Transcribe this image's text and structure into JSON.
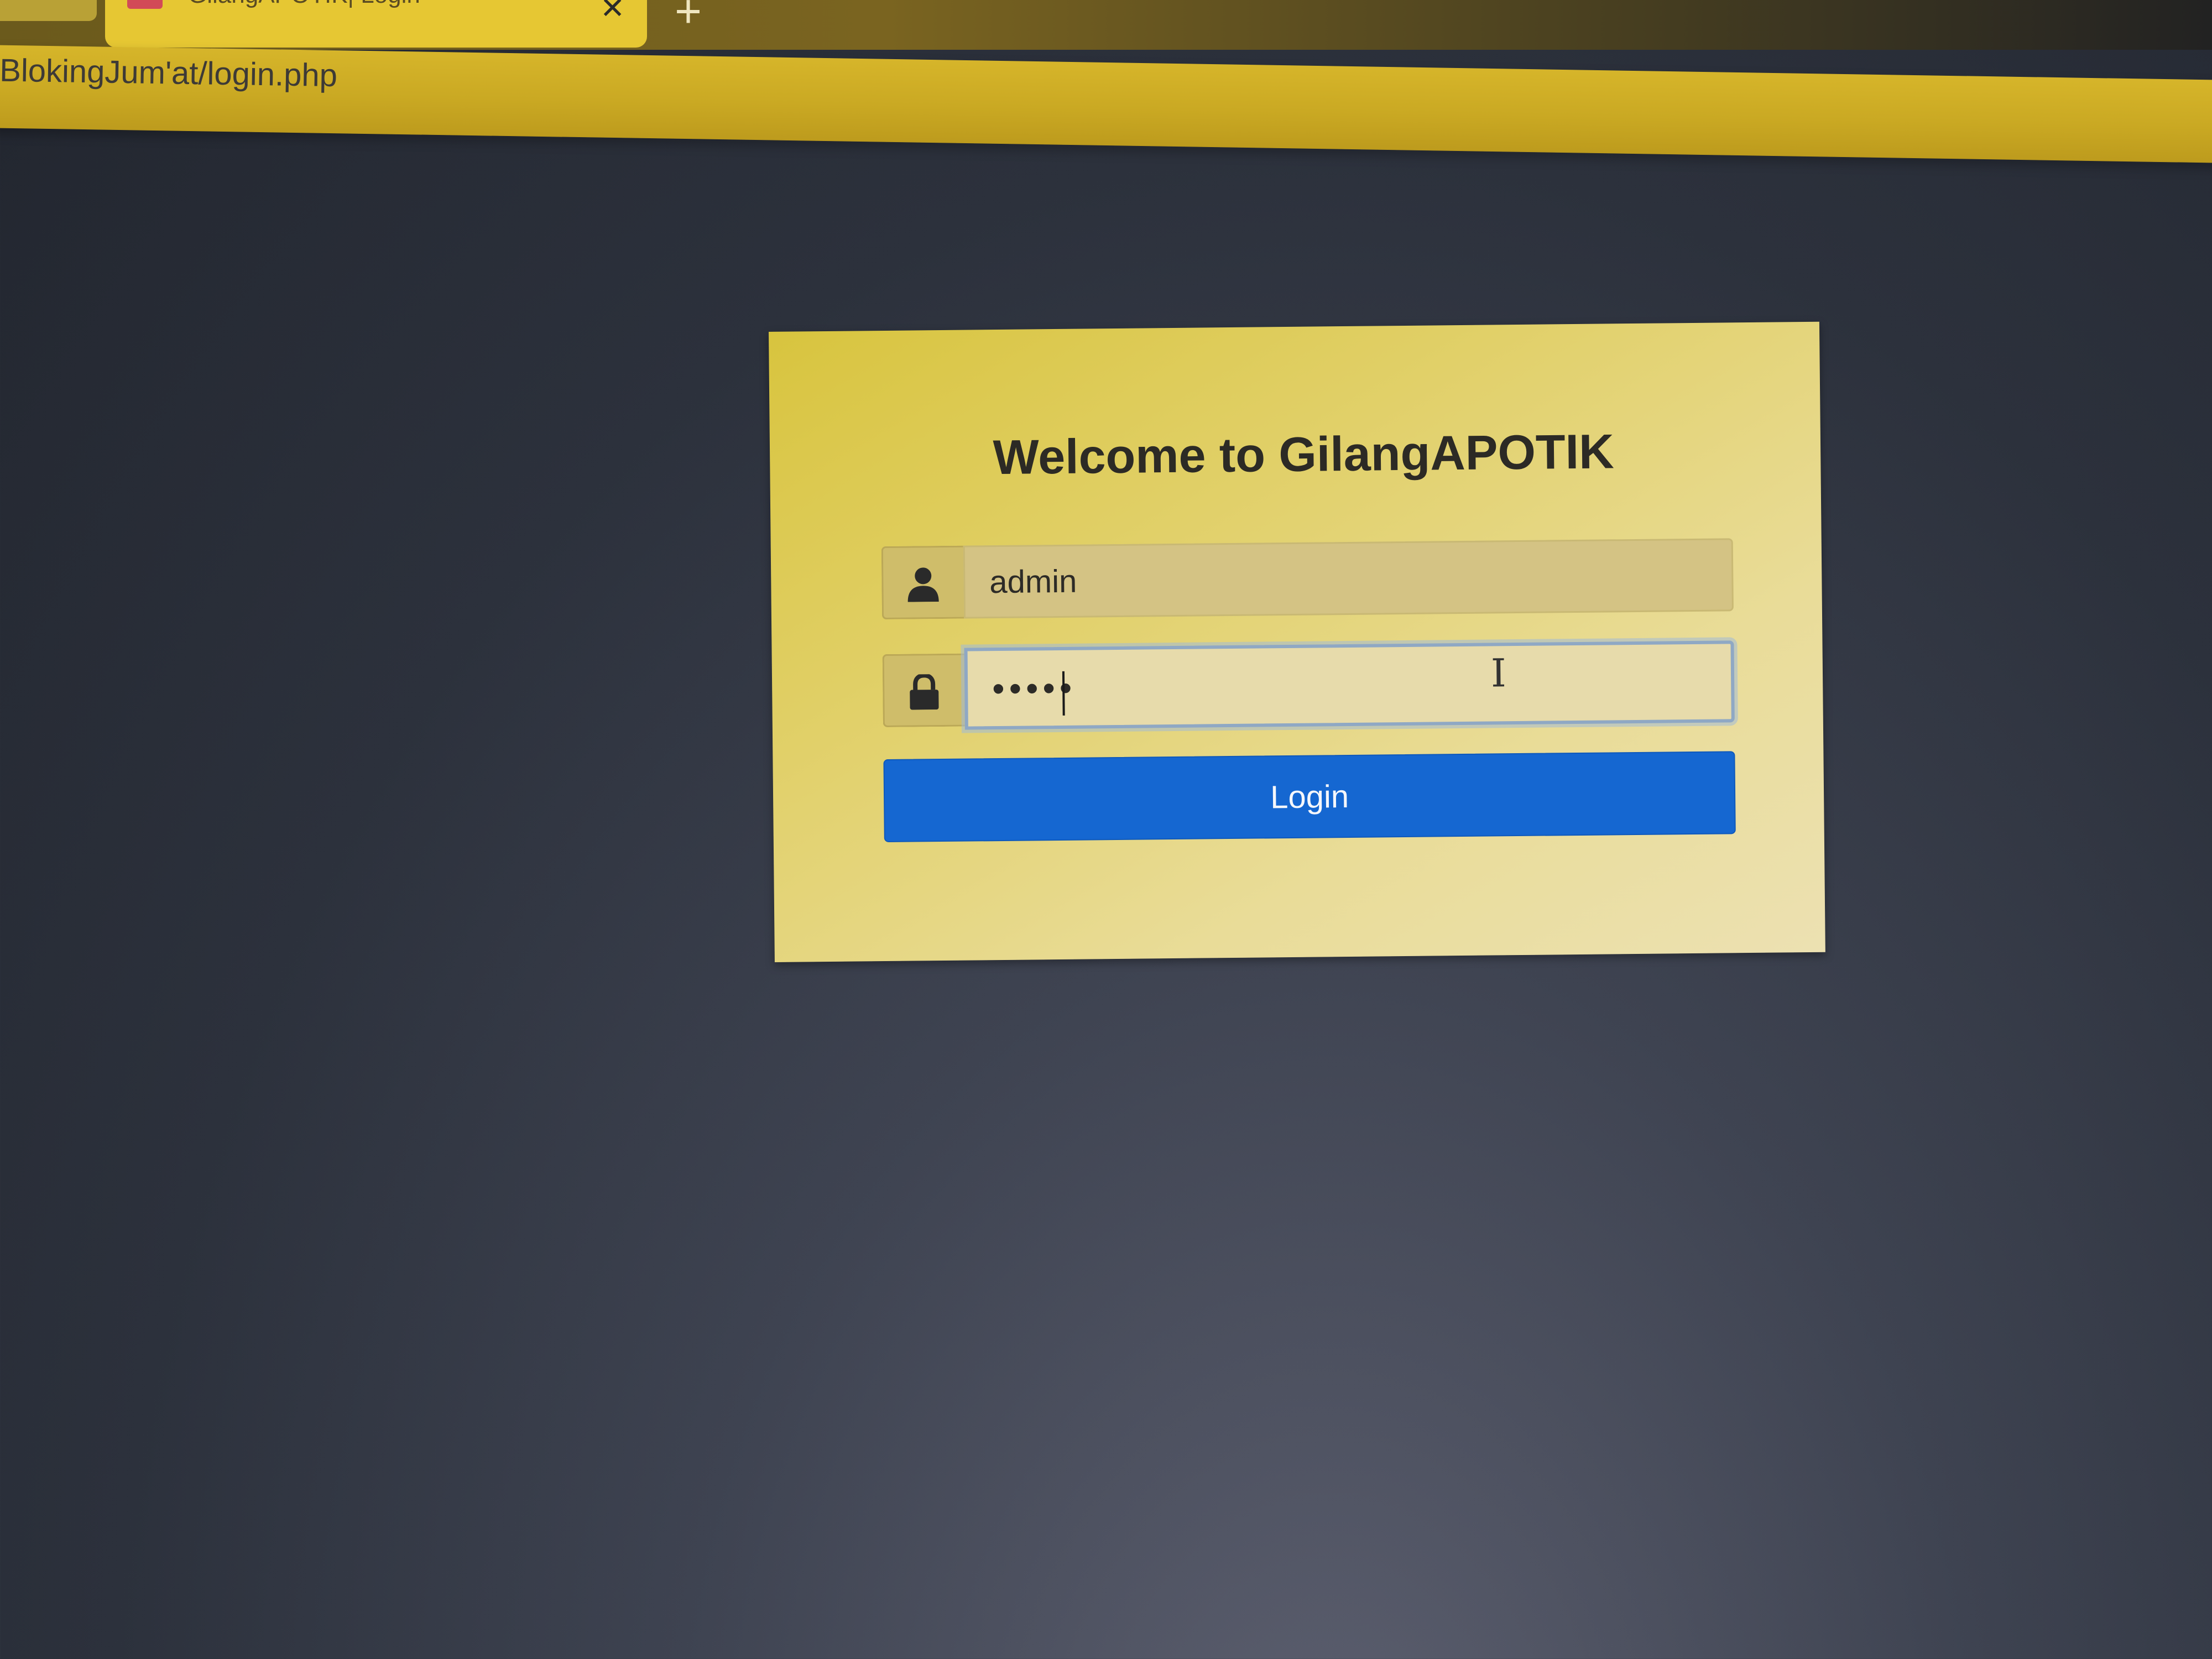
{
  "browser": {
    "tab_title": "GilangAPOTIK| Login",
    "tab_close_glyph": "✕",
    "new_tab_glyph": "+",
    "url": "BlokingJum'at/login.php",
    "favicon_color": "#d24a57",
    "chrome_color": "#e6c733"
  },
  "login": {
    "title": "Welcome to GilangAPOTIK",
    "username": {
      "value": "admin",
      "icon": "user-icon"
    },
    "password": {
      "value": "•••••",
      "icon": "lock-icon"
    },
    "button_label": "Login",
    "button_color": "#1567d1",
    "card_color": "#e1d069"
  }
}
